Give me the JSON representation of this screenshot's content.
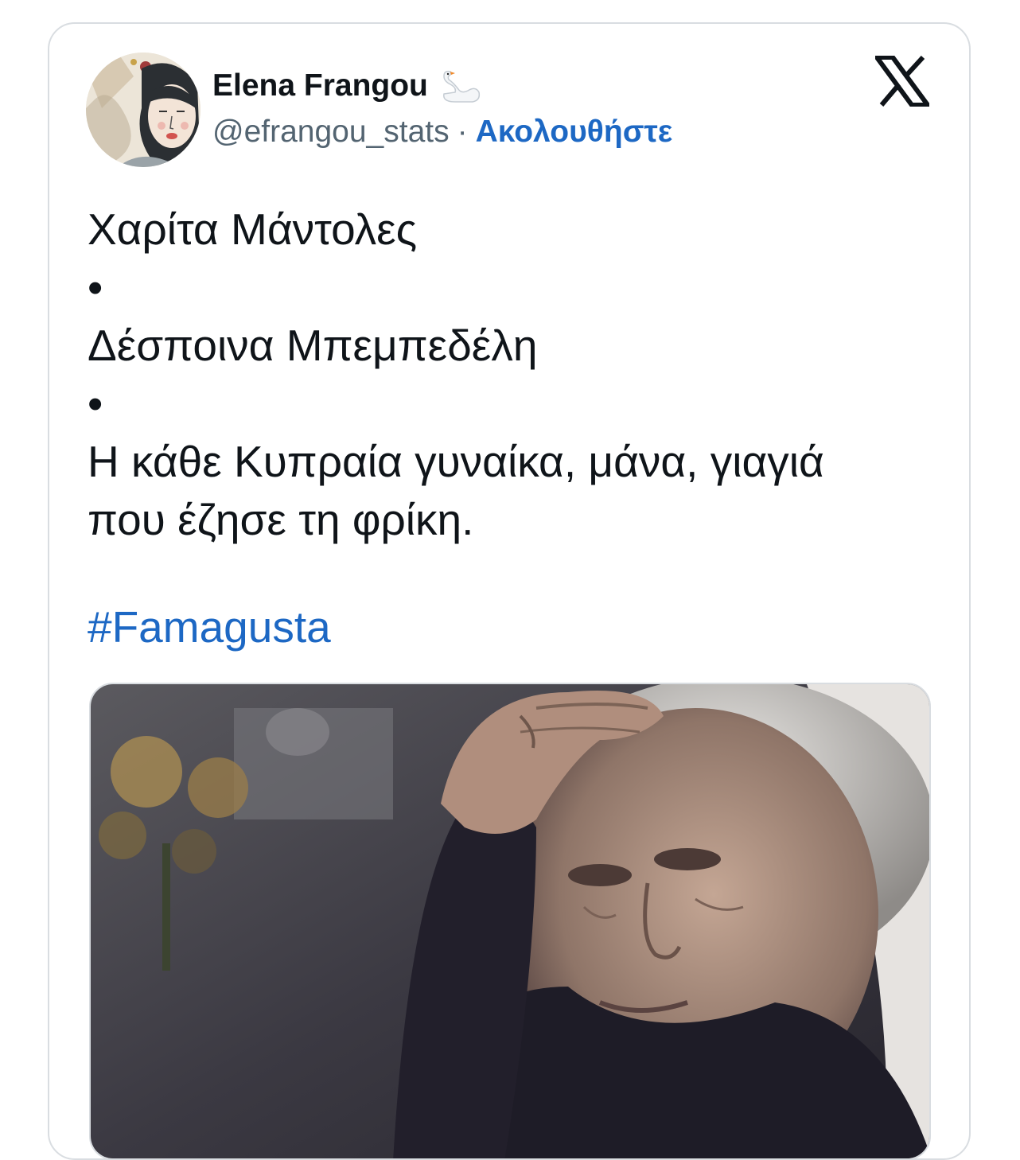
{
  "author": {
    "name": "Elena Frangou",
    "handle": "@efrangou_stats",
    "separator": "·",
    "follow_label": "Ακολουθήστε",
    "name_emoji_icon": "swan-icon"
  },
  "platform_icon": "x-logo-icon",
  "tweet": {
    "lines": [
      "Χαρίτα Μάντολες",
      "•",
      "Δέσποινα Μπεμπεδέλη",
      "•",
      "Η κάθε Κυπραία γυναίκα, μάνα, γιαγιά",
      "που έζησε τη φρίκη."
    ],
    "hashtag": "#Famagusta"
  },
  "media": {
    "type": "photo"
  },
  "colors": {
    "link": "#1d68c4",
    "text": "#0f1419",
    "secondary": "#536471",
    "border": "#d9dde1"
  }
}
